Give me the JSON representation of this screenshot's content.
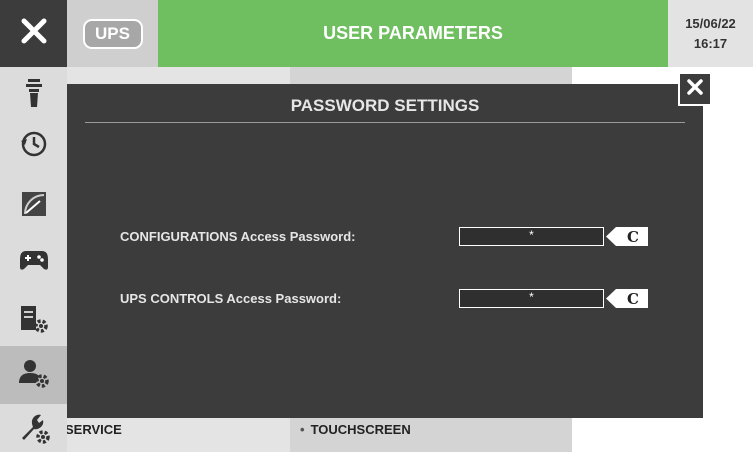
{
  "header": {
    "ups_label": "UPS",
    "title": "USER PARAMETERS",
    "date": "15/06/22",
    "time": "16:17"
  },
  "sidebar": {
    "items": [
      {
        "icon": "signal-tower-icon"
      },
      {
        "icon": "history-clock-icon"
      },
      {
        "icon": "gauge-icon"
      },
      {
        "icon": "gamepad-icon"
      },
      {
        "icon": "device-settings-icon"
      },
      {
        "icon": "user-settings-icon",
        "active": true
      },
      {
        "icon": "wrench-settings-icon"
      }
    ]
  },
  "background_page": {
    "service_label": "SERVICE",
    "touchscreen_label": "TOUCHSCREEN"
  },
  "dialog": {
    "title": "PASSWORD SETTINGS",
    "fields": [
      {
        "label": "CONFIGURATIONS Access Password:",
        "value": "*",
        "clear_label": "C"
      },
      {
        "label": "UPS CONTROLS Access Password:",
        "value": "*",
        "clear_label": "C"
      }
    ]
  },
  "colors": {
    "accent_green": "#6fbe5f",
    "dialog_bg": "#3c3c3c",
    "sidebar_bg": "#dcdcdc"
  }
}
